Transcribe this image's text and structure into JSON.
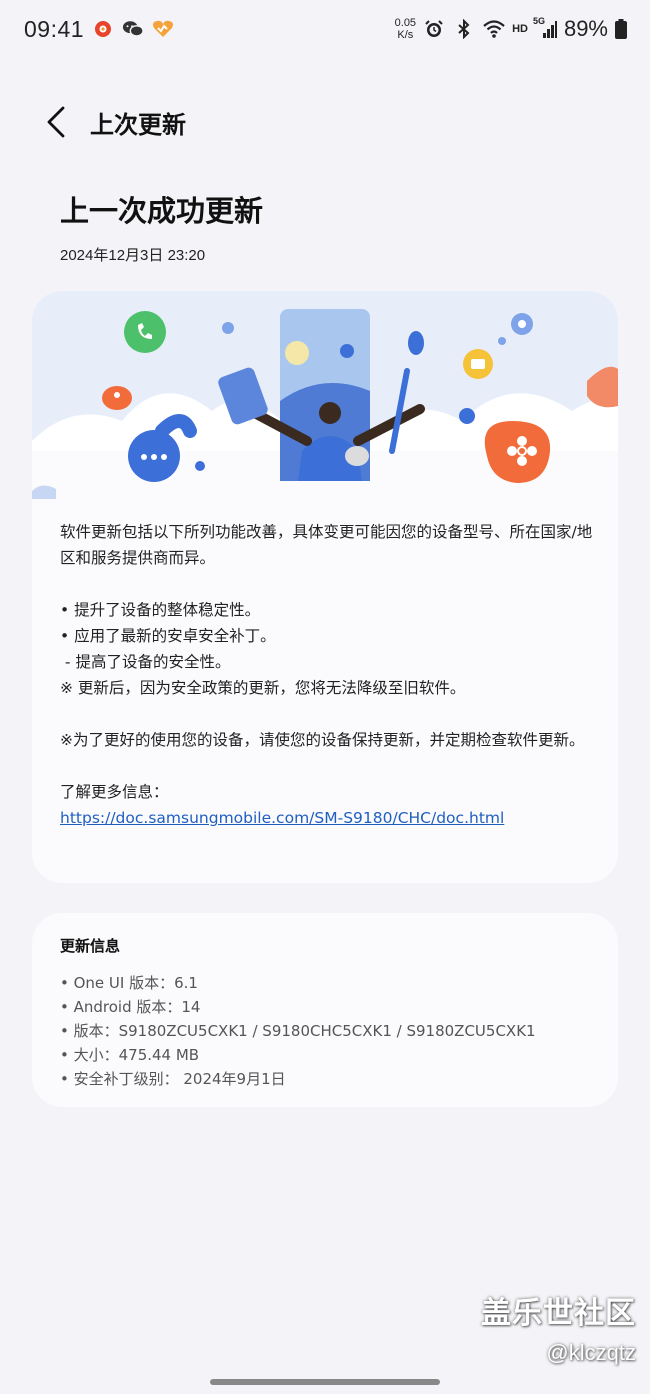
{
  "status_bar": {
    "time": "09:41",
    "net_speed_value": "0.05",
    "net_speed_unit": "K/s",
    "hd_label": "HD",
    "network_label": "5G",
    "battery": "89%",
    "icons": [
      "app-notification-icon",
      "wechat-icon",
      "app-heart-icon",
      "alarm-icon",
      "bluetooth-icon",
      "wifi-icon",
      "signal-icon",
      "battery-icon"
    ]
  },
  "header": {
    "title": "上次更新",
    "back_icon": "chevron-left-icon"
  },
  "page": {
    "title": "上一次成功更新",
    "date": "2024年12月3日 23:20"
  },
  "notes": {
    "intro": "软件更新包括以下所列功能改善，具体变更可能因您的设备型号、所在国家/地区和服务提供商而异。",
    "items": [
      "• 提升了设备的整体稳定性。",
      "• 应用了最新的安卓安全补丁。",
      " - 提高了设备的安全性。",
      "※ 更新后，因为安全政策的更新，您将无法降级至旧软件。"
    ],
    "advice": "※为了更好的使用您的设备，请使您的设备保持更新，并定期检查软件更新。",
    "more_info_label": "了解更多信息：",
    "more_info_link": "https://doc.samsungmobile.com/SM-S9180/CHC/doc.html"
  },
  "update_info": {
    "title": "更新信息",
    "items": [
      "• One UI 版本：6.1",
      "• Android 版本：14",
      "• 版本：S9180ZCU5CXK1 / S9180CHC5CXK1 / S9180ZCU5CXK1",
      "• 大小：475.44 MB",
      "• 安全补丁级别： 2024年9月1日"
    ]
  },
  "watermark": {
    "line1": "盖乐世社区",
    "line2": "@klczqtz"
  },
  "colors": {
    "background": "#f4f4f8",
    "card": "#fbfbfd",
    "link": "#1f5fbf",
    "accent_blue": "#3c6fd8",
    "accent_green": "#4cc06a",
    "accent_orange": "#f26b3a"
  }
}
